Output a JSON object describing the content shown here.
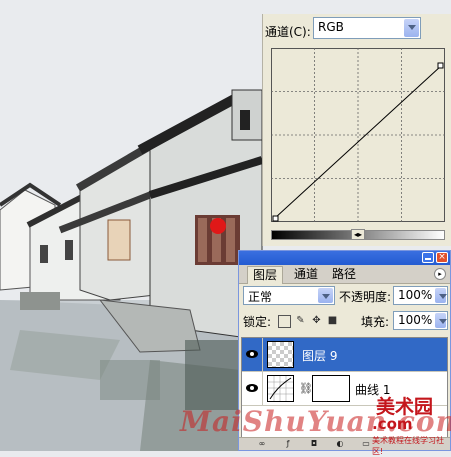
{
  "curves": {
    "channel_label": "通道(C):",
    "channel_value": "RGB"
  },
  "layers_panel": {
    "tabs": [
      {
        "label": "图层",
        "active": true
      },
      {
        "label": "通道",
        "active": false
      },
      {
        "label": "路径",
        "active": false
      }
    ],
    "blend_mode": "正常",
    "opacity_label": "不透明度:",
    "opacity_value": "100%",
    "lock_label": "锁定:",
    "fill_label": "填充:",
    "fill_value": "100%",
    "layers": [
      {
        "name": "图层 9",
        "selected": true,
        "visible": true
      },
      {
        "name": "曲线 1",
        "selected": false,
        "visible": true
      }
    ]
  },
  "watermark": {
    "main": "MaiShuYuan.com",
    "cn": "美术园",
    "domain": ".com",
    "sub": "美术教程在线学习社区!"
  },
  "colors": {
    "selection": "#3169c6",
    "titlebar": "#235bd1",
    "watermark": "#c4161c"
  }
}
